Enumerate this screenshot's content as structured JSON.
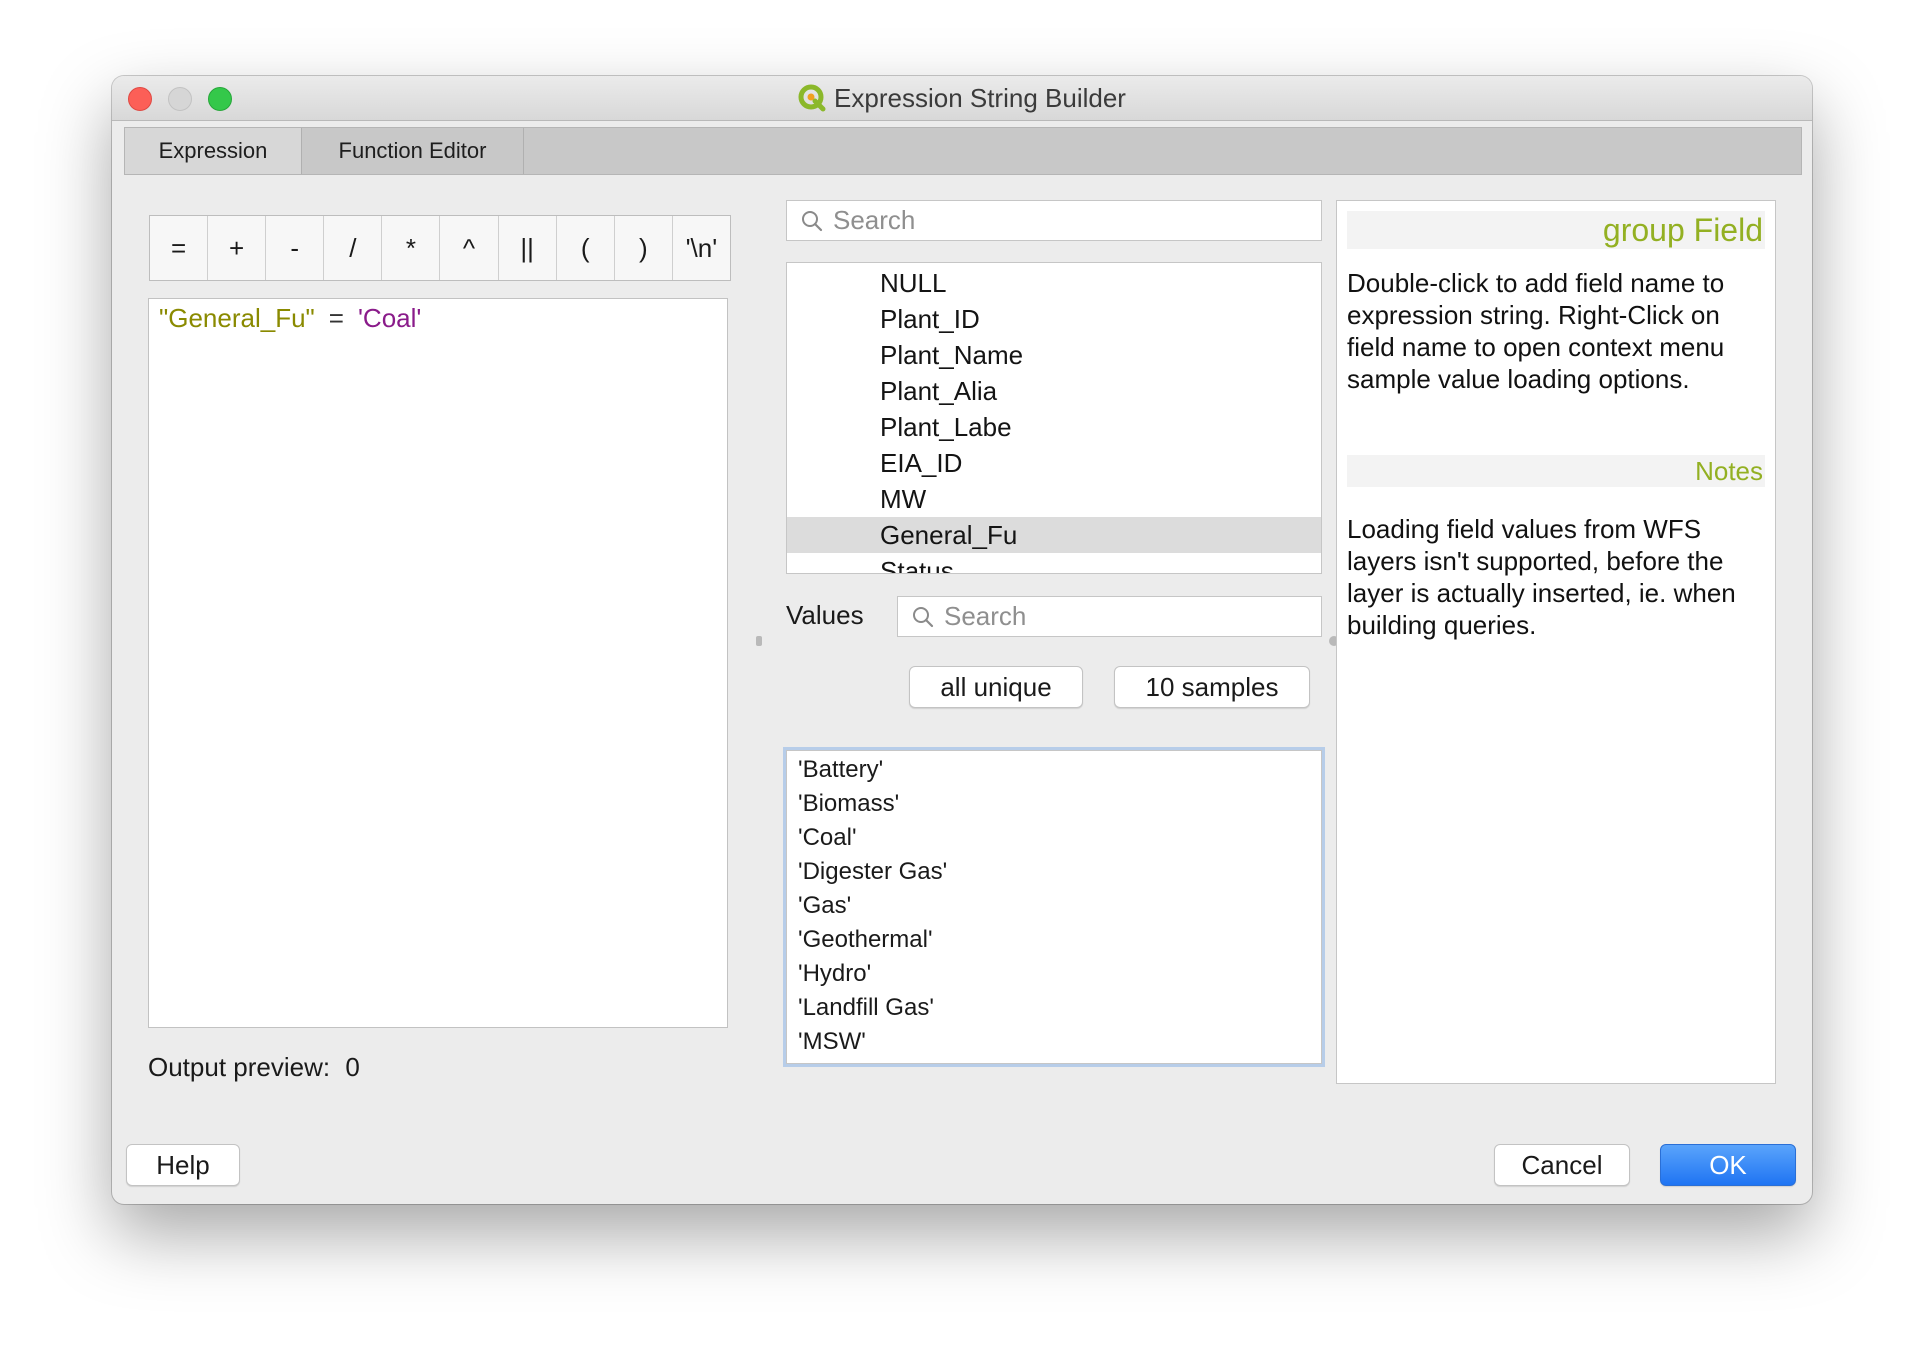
{
  "window": {
    "title": "Expression String Builder"
  },
  "tabs": [
    {
      "label": "Expression"
    },
    {
      "label": "Function Editor"
    }
  ],
  "operators": [
    "=",
    "+",
    "-",
    "/",
    "*",
    "^",
    "||",
    "(",
    ")",
    "'\\n'"
  ],
  "expression": {
    "field": "\"General_Fu\"",
    "operator": "=",
    "value": "'Coal'"
  },
  "output_preview": {
    "label": "Output preview:",
    "value": "0"
  },
  "field_search": {
    "placeholder": "Search"
  },
  "fields": {
    "items": [
      "NULL",
      "Plant_ID",
      "Plant_Name",
      "Plant_Alia",
      "Plant_Labe",
      "EIA_ID",
      "MW",
      "General_Fu",
      "Status"
    ],
    "selected": "General_Fu"
  },
  "values_section": {
    "label": "Values",
    "search_placeholder": "Search",
    "all_unique_label": "all unique",
    "samples_label": "10 samples",
    "items": [
      "'Battery'",
      "'Biomass'",
      "'Coal'",
      "'Digester Gas'",
      "'Gas'",
      "'Geothermal'",
      "'Hydro'",
      "'Landfill Gas'",
      "'MSW'"
    ]
  },
  "help": {
    "group_title": "group Field",
    "description": "Double-click to add field name to expression string. Right-Click on field name to open context menu sample value loading options.",
    "notes_title": "Notes",
    "notes_text": "Loading field values from WFS layers isn't supported, before the layer is actually inserted, ie. when building queries."
  },
  "buttons": {
    "help": "Help",
    "cancel": "Cancel",
    "ok": "OK"
  },
  "colors": {
    "field_token": "#8a8a00",
    "string_token": "#8a1b8a",
    "help_header": "#93b022",
    "ok_button": "#1f74f3"
  }
}
